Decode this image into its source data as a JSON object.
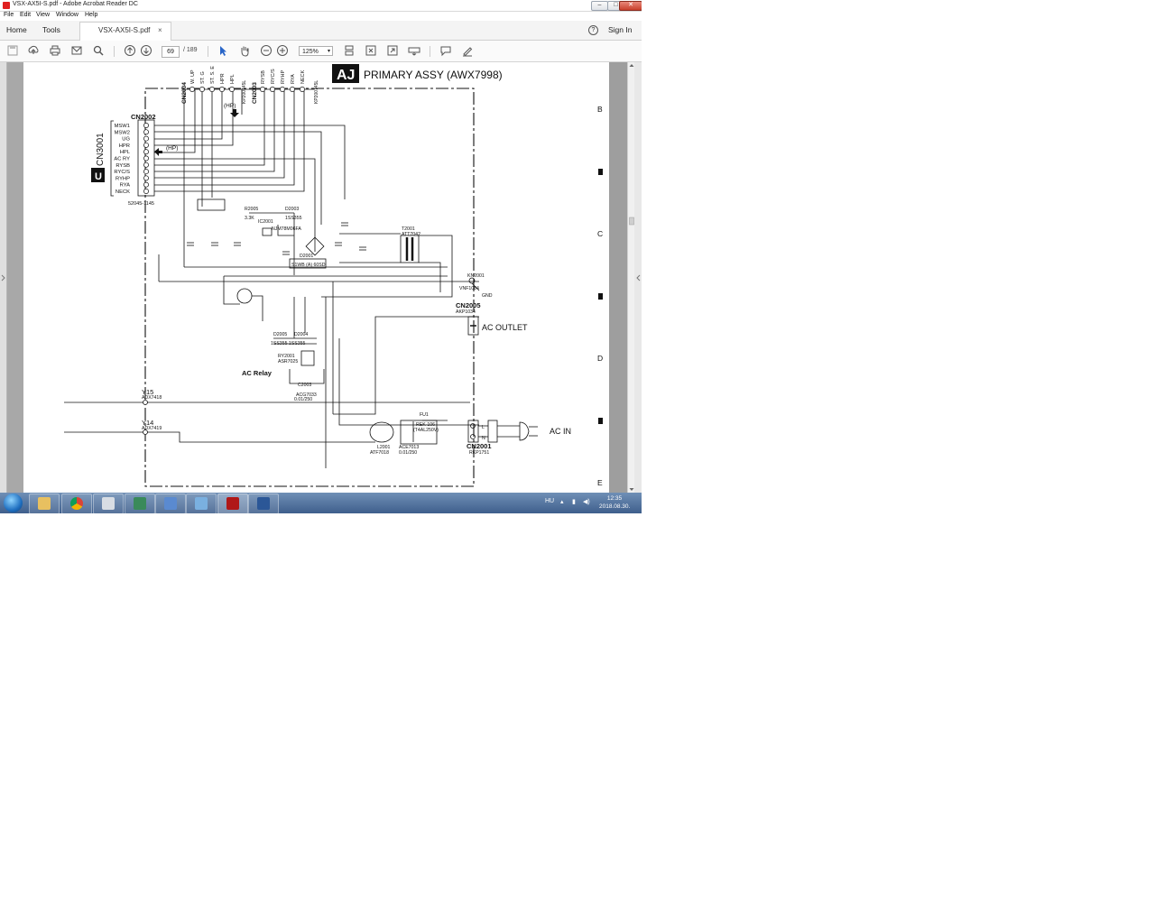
{
  "window": {
    "title": "VSX-AX5I-S.pdf - Adobe Acrobat Reader DC",
    "controls": {
      "minimize": "–",
      "maximize": "□",
      "close": "✕"
    }
  },
  "menu": [
    "File",
    "Edit",
    "View",
    "Window",
    "Help"
  ],
  "tabs": {
    "home": "Home",
    "tools": "Tools",
    "document": "VSX-AX5I-S.pdf",
    "close": "×"
  },
  "header": {
    "help": "?",
    "sign_in": "Sign In"
  },
  "toolbar": {
    "page_current": "69",
    "page_total": "/ 189",
    "zoom": "125%",
    "icons": [
      "save-icon",
      "upload-icon",
      "print-icon",
      "email-icon",
      "search-icon",
      "prev-page-icon",
      "next-page-icon",
      "select-arrow-icon",
      "hand-icon",
      "zoom-out-icon",
      "zoom-in-icon",
      "scroll-mode-icon",
      "fit-page-icon",
      "fullscreen-icon",
      "read-mode-icon",
      "comment-icon",
      "sign-pen-icon"
    ]
  },
  "schematic": {
    "badge": "AJ",
    "title": "PRIMARY ASSY (AWX7998)",
    "grid_letters": [
      "B",
      "C",
      "D",
      "E"
    ],
    "side_badge": "U",
    "cn3001": "CN3001",
    "cn2002": "CN2002",
    "cn2002_pins": [
      "MSW1",
      "MSW2",
      "UG",
      "HPR",
      "HPL",
      "AC RY",
      "RYSB",
      "RYC/S",
      "RYHP",
      "RYA",
      "NECK"
    ],
    "cn2002_part": "52045-1145",
    "cn2004": "CN2004",
    "cn2004_pins": [
      "W. UP",
      "ST. G",
      "ST. S. E",
      "HPR",
      "HPL"
    ],
    "cn2004_part": "KP200745L",
    "cn2003": "CN2003",
    "cn2003_pins": [
      "RYSB",
      "RYC/S",
      "RYHP",
      "RYA",
      "NECK"
    ],
    "cn2003_part": "KP200745L",
    "hp_label": "(HP)",
    "r2005": "R2005",
    "r2005_val": "3.3K",
    "d2003": "D2003",
    "d2003_val": "1SS355",
    "ic2001": "IC2001",
    "ic2001_val": "NJM78M06FA",
    "t2001": "T2001",
    "t2001_val": "ATT7042",
    "d2001": "D2001",
    "d2001_val": "S1WB (A) 60SD",
    "cn2005": "CN2005",
    "cn2005_part": "AKP1034",
    "ac_outlet": "AC OUTLET",
    "ac_relay": "AC Relay",
    "d2005": "D2005",
    "d2004": "D2004",
    "diodes_val": "1SS355 1SS355",
    "ry2001": "RY2001",
    "ry2001_val": "ASR7025",
    "c2003": "C2003",
    "c2003_val": "ACG7033",
    "c2003_cap": "0.01/250",
    "y15": "Y15",
    "y15_part": "ADX7418",
    "y14": "Y14",
    "y14_part": "ADX7419",
    "l2001": "L2001",
    "l2001_part": "ATF7018",
    "fu1": "FU1",
    "fu1_val": "REK-106",
    "fu1_rating": "(T4AL250V)",
    "ace_part": "ACE7013",
    "ace_cap": "0.01/250",
    "cn2001": "CN2001",
    "cn2001_part": "RKP1751",
    "ac_in": "AC IN",
    "kn2001": "KN2001",
    "kn2001_part": "VNF1084",
    "gnd": "GND",
    "pin_l": "L",
    "pin_n": "N"
  },
  "taskbar": {
    "apps": [
      "explorer",
      "chrome",
      "calculator",
      "finance-app",
      "control-panel",
      "mail-app",
      "acrobat-reader",
      "word"
    ],
    "language": "HU",
    "time": "12:35",
    "date": "2018.08.30."
  }
}
